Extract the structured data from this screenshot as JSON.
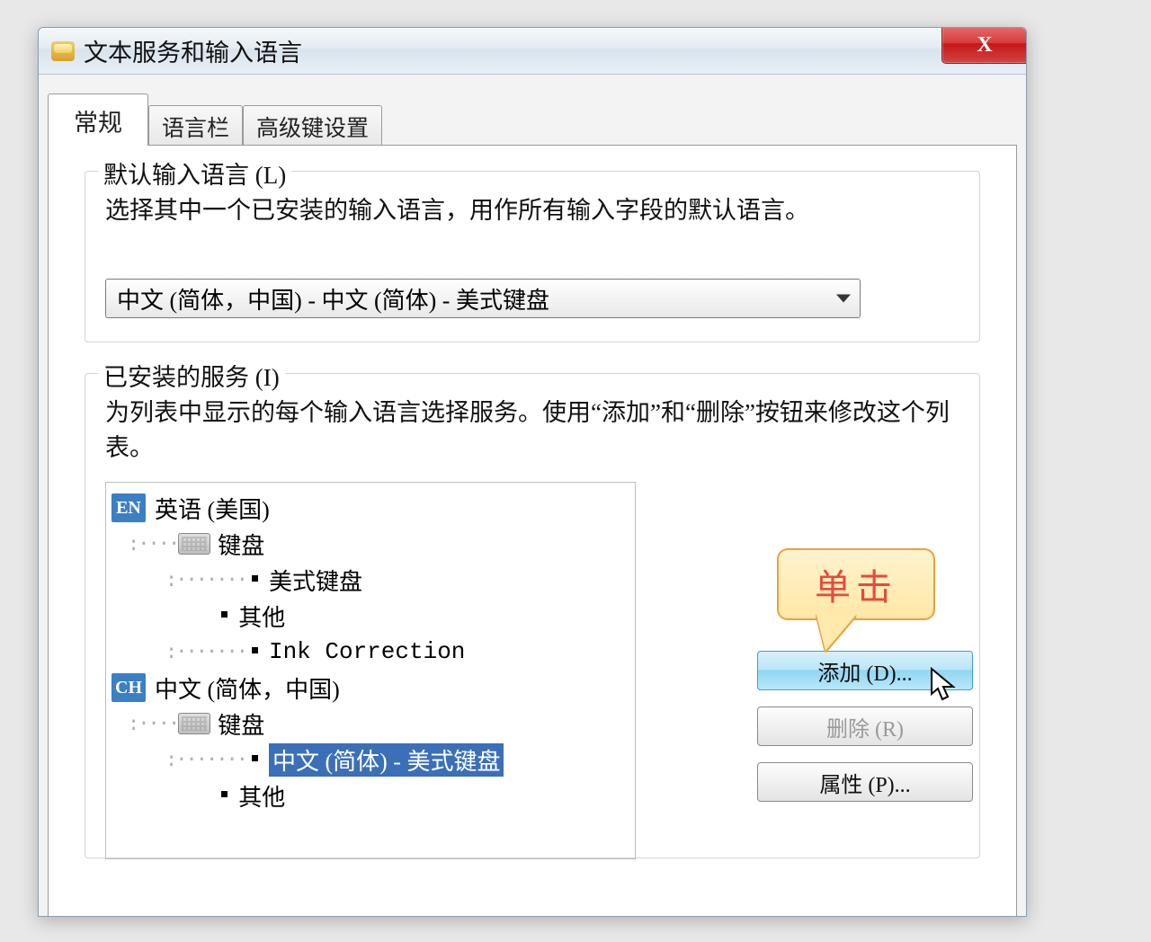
{
  "window": {
    "title": "文本服务和输入语言",
    "close_label": "X"
  },
  "tabs": [
    {
      "label": "常规"
    },
    {
      "label": "语言栏"
    },
    {
      "label": "高级键设置"
    }
  ],
  "default_lang": {
    "legend": "默认输入语言 (L)",
    "desc": "选择其中一个已安装的输入语言，用作所有输入字段的默认语言。",
    "selected": "中文 (简体，中国) - 中文 (简体) - 美式键盘"
  },
  "services": {
    "legend": "已安装的服务 (I)",
    "desc": "为列表中显示的每个输入语言选择服务。使用“添加”和“删除”按钮来修改这个列表。",
    "tree": {
      "en_badge": "EN",
      "en_label": "英语 (美国)",
      "keyboard_label": "键盘",
      "en_kb1": "美式键盘",
      "other_label": "其他",
      "en_other1": "Ink Correction",
      "ch_badge": "CH",
      "ch_label": "中文 (简体，中国)",
      "ch_kb1_selected": "中文 (简体) - 美式键盘",
      "ch_other_label": "其他"
    }
  },
  "buttons": {
    "add": "添加 (D)...",
    "remove": "删除 (R)",
    "properties": "属性 (P)..."
  },
  "callout": {
    "text": "单击"
  }
}
